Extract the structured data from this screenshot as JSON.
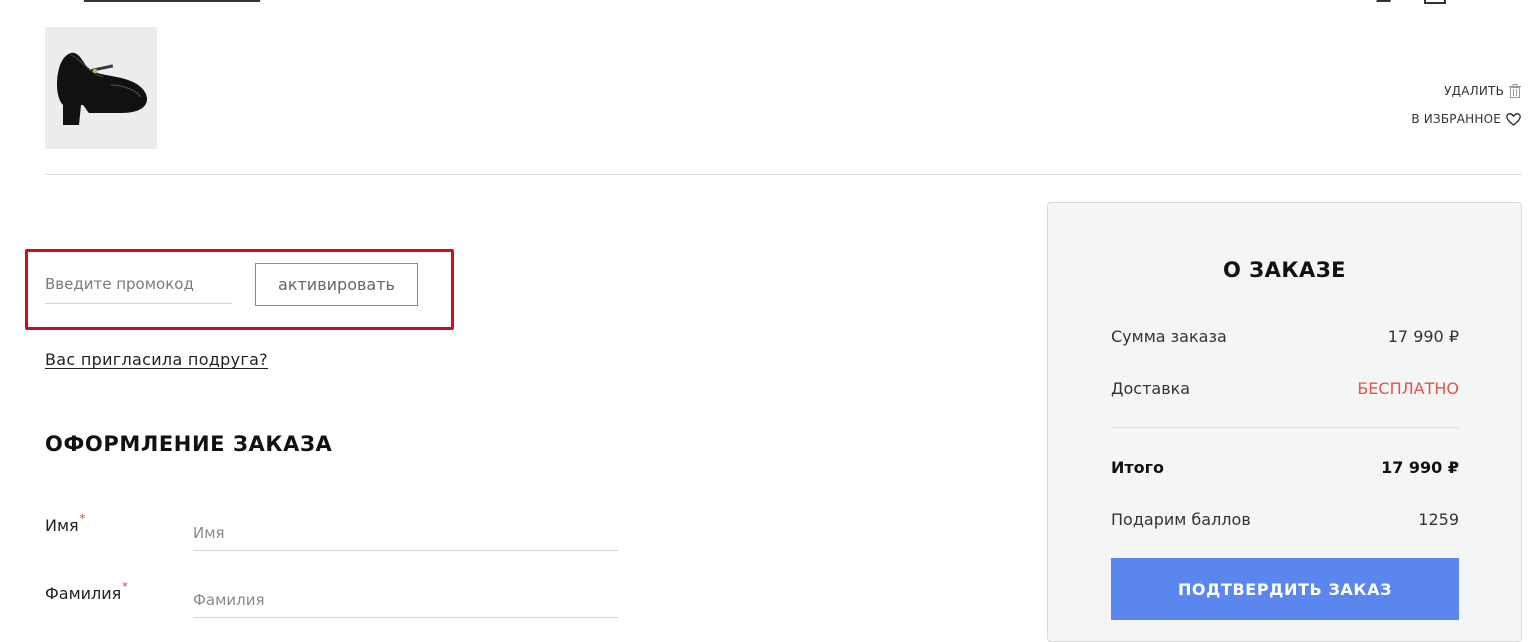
{
  "item": {
    "image_icon": "shoe-image",
    "remove_label": "УДАЛИТЬ",
    "remove_icon": "trash-icon",
    "favorite_label": "В ИЗБРАННОЕ",
    "favorite_icon": "heart-icon"
  },
  "promo": {
    "placeholder": "Введите промокод",
    "value": "",
    "button_label": "активировать",
    "highlight_color": "#c8101e"
  },
  "invite_link": "Вас пригласила подруга?",
  "checkout": {
    "title": "ОФОРМЛЕНИЕ ЗАКАЗА",
    "fields": [
      {
        "label": "Имя",
        "required_mark": "*",
        "placeholder": "Имя",
        "value": ""
      },
      {
        "label": "Фамилия",
        "required_mark": "*",
        "placeholder": "Фамилия",
        "value": ""
      }
    ]
  },
  "summary": {
    "title": "О ЗАКАЗЕ",
    "order_sum_label": "Сумма заказа",
    "order_sum_value": "17 990 ₽",
    "delivery_label": "Доставка",
    "delivery_value": "БЕСПЛАТНО",
    "total_label": "Итого",
    "total_value": "17 990 ₽",
    "bonus_label": "Подарим баллов",
    "bonus_value": "1259",
    "confirm_label": "ПОДТВЕРДИТЬ ЗАКАЗ",
    "accent_color": "#5b86ee",
    "free_color": "#e0554f"
  }
}
